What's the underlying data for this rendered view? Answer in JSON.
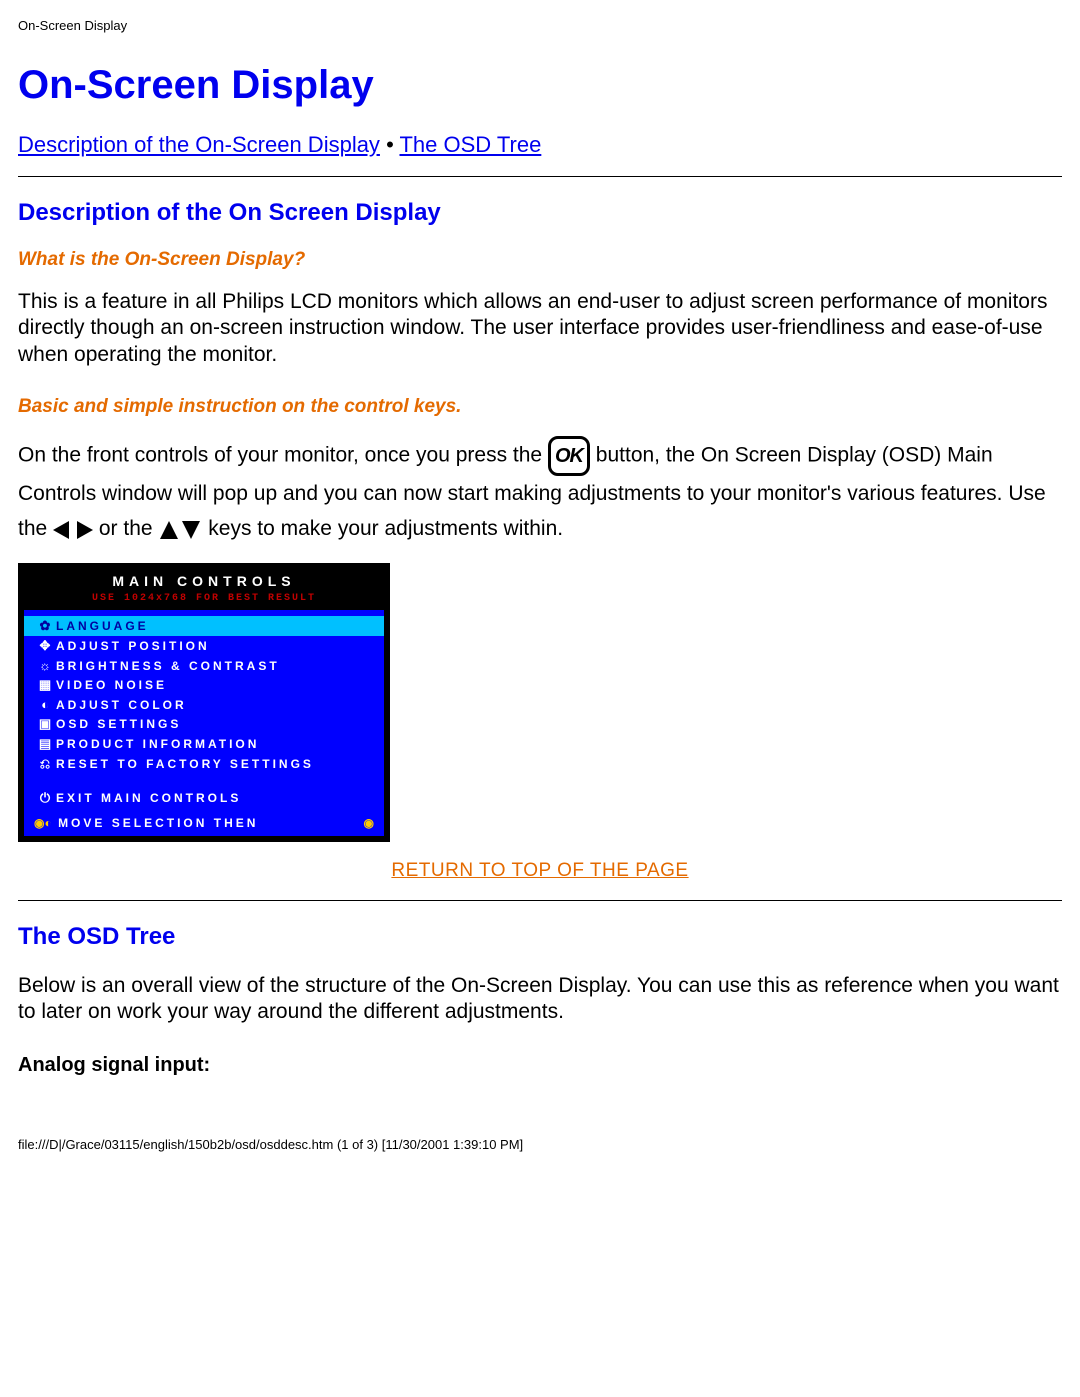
{
  "header_small": "On-Screen Display",
  "title": "On-Screen Display",
  "nav": {
    "link1": "Description of the On-Screen Display",
    "link2": "The OSD Tree"
  },
  "section1": {
    "heading": "Description of the On Screen Display",
    "sub1": "What is the On-Screen Display?",
    "para1": "This is a feature in all Philips LCD monitors which allows an end-user to adjust screen performance of monitors directly though an on-screen instruction window. The user interface provides user-friendliness and ease-of-use when operating the monitor.",
    "sub2": "Basic and simple instruction on the control keys.",
    "flow_a": "On the front controls of your monitor, once you press the ",
    "flow_b": " button, the On Screen Display (OSD) Main Controls window will pop up and you can now start making adjustments to your monitor's various features. Use the ",
    "flow_c": " or the ",
    "flow_d": " keys to make your adjustments within."
  },
  "osd": {
    "title": "MAIN CONTROLS",
    "warn": "USE 1024x768 FOR BEST RESULT",
    "items": [
      "LANGUAGE",
      "ADJUST POSITION",
      "BRIGHTNESS & CONTRAST",
      "VIDEO NOISE",
      "ADJUST COLOR",
      "OSD SETTINGS",
      "PRODUCT INFORMATION",
      "RESET TO FACTORY SETTINGS"
    ],
    "exit": "EXIT MAIN CONTROLS",
    "footer": "MOVE SELECTION THEN"
  },
  "return_link": "RETURN TO TOP OF THE PAGE",
  "section2": {
    "heading": "The OSD Tree",
    "para": "Below is an overall view of the structure of the On-Screen Display. You can use this as reference when you want to later on work your way around the different adjustments.",
    "analog": "Analog signal input:"
  },
  "footer_path": "file:///D|/Grace/03115/english/150b2b/osd/osddesc.htm (1 of 3) [11/30/2001 1:39:10 PM]"
}
